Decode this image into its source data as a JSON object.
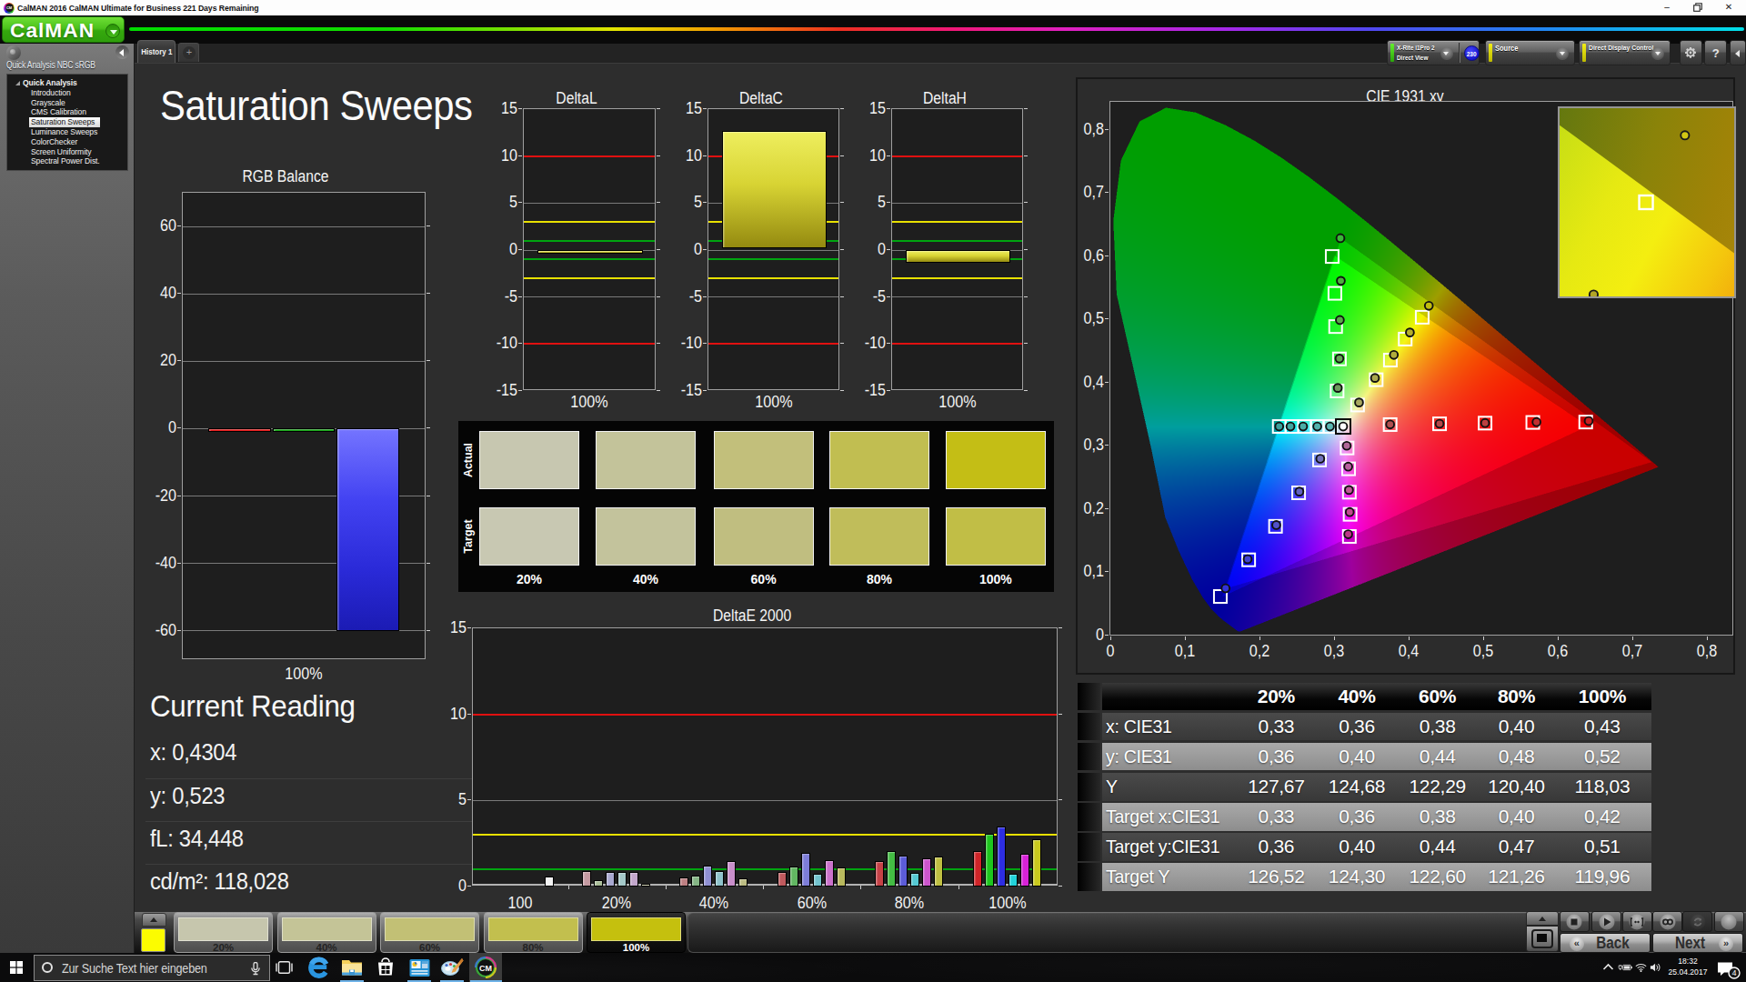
{
  "window": {
    "title": "CalMAN 2016 CalMAN Ultimate for Business 221 Days Remaining",
    "controls": {
      "minimize": "–",
      "restore": "❐",
      "close": "✕"
    }
  },
  "logo": {
    "text": "CalMAN"
  },
  "tabs": {
    "active": "History 1",
    "add": "+"
  },
  "toolbar": {
    "meter": {
      "line1": "X-Rite i1Pro 2",
      "line2": "Direct View",
      "badge": "230"
    },
    "source": {
      "label": "Source"
    },
    "display_control": {
      "label": "Direct Display Control"
    },
    "help": "?"
  },
  "sidebar": {
    "title": "Quick Analysis NBC sRGB",
    "root": "Quick Analysis",
    "items": [
      "Introduction",
      "Grayscale",
      "CMS Calibration",
      "Saturation Sweeps",
      "Luminance Sweeps",
      "ColorChecker",
      "Screen Uniformity",
      "Spectral Power Dist."
    ],
    "selected_index": 3
  },
  "page": {
    "title": "Saturation Sweeps"
  },
  "current_reading": {
    "title": "Current Reading",
    "lines": [
      "x: 0,4304",
      "y: 0,523",
      "fL: 34,448",
      "cd/m²: 118,028"
    ]
  },
  "chart_data": [
    {
      "id": "rgbbalance",
      "type": "bar",
      "title": "RGB Balance",
      "categories": [
        "100%"
      ],
      "ylim": [
        -68.7,
        70
      ],
      "yticks": [
        60,
        40,
        20,
        0,
        -20,
        -40,
        -60
      ],
      "series": [
        {
          "name": "Red",
          "values": [
            -1.0
          ],
          "color": "#e01414"
        },
        {
          "name": "Green",
          "values": [
            -0.9
          ],
          "color": "#12a012"
        },
        {
          "name": "Blue",
          "values": [
            -60.0
          ],
          "color": "blueGradient"
        }
      ],
      "xlabel": "100%"
    },
    {
      "id": "deltaL",
      "type": "bar",
      "title": "DeltaL",
      "categories": [
        "100%"
      ],
      "ylim": [
        -15,
        15
      ],
      "yticks": [
        15,
        10,
        5,
        0,
        -5,
        -10,
        -15
      ],
      "reflines": [
        {
          "v": 10,
          "c": "red"
        },
        {
          "v": -10,
          "c": "red"
        },
        {
          "v": 3,
          "c": "yellow"
        },
        {
          "v": -3,
          "c": "yellow"
        },
        {
          "v": 1,
          "c": "green"
        },
        {
          "v": -1,
          "c": "green"
        }
      ],
      "series": [
        {
          "name": "DeltaL",
          "values": [
            -0.35
          ],
          "color": "yellowGradient"
        }
      ],
      "xlabel": "100%"
    },
    {
      "id": "deltaC",
      "type": "bar",
      "title": "DeltaC",
      "categories": [
        "100%"
      ],
      "ylim": [
        -15,
        15
      ],
      "yticks": [
        15,
        10,
        5,
        0,
        -5,
        -10,
        -15
      ],
      "reflines": [
        {
          "v": 10,
          "c": "red"
        },
        {
          "v": -10,
          "c": "red"
        },
        {
          "v": 3,
          "c": "yellow"
        },
        {
          "v": -3,
          "c": "yellow"
        },
        {
          "v": 1,
          "c": "green"
        },
        {
          "v": -1,
          "c": "green"
        }
      ],
      "series": [
        {
          "name": "DeltaC",
          "values": [
            12.7
          ],
          "color": "yellowGradient",
          "base": 0.2
        }
      ],
      "xlabel": "100%"
    },
    {
      "id": "deltaH",
      "type": "bar",
      "title": "DeltaH",
      "categories": [
        "100%"
      ],
      "ylim": [
        -15,
        15
      ],
      "yticks": [
        15,
        10,
        5,
        0,
        -5,
        -10,
        -15
      ],
      "reflines": [
        {
          "v": 10,
          "c": "red"
        },
        {
          "v": -10,
          "c": "red"
        },
        {
          "v": 3,
          "c": "yellow"
        },
        {
          "v": -3,
          "c": "yellow"
        },
        {
          "v": 1,
          "c": "green"
        },
        {
          "v": -1,
          "c": "green"
        }
      ],
      "series": [
        {
          "name": "DeltaH",
          "values": [
            -1.4
          ],
          "color": "yellowGradient"
        }
      ],
      "xlabel": "100%"
    },
    {
      "id": "deltaE",
      "type": "bar",
      "title": "DeltaE 2000",
      "categories": [
        "100",
        "20%",
        "40%",
        "60%",
        "80%",
        "100%"
      ],
      "ylim": [
        0,
        15
      ],
      "yticks": [
        15,
        10,
        5,
        0
      ],
      "reflines": [
        {
          "v": 10,
          "c": "red"
        },
        {
          "v": 3,
          "c": "yellow"
        },
        {
          "v": 1,
          "c": "green"
        }
      ],
      "groups": [
        {
          "label": "100",
          "bars": [
            {
              "v": 0.56,
              "color": "#f2f2f2",
              "slot": 5
            }
          ]
        },
        {
          "label": "20%",
          "bars": [
            {
              "v": 0.89,
              "color": "#c59aa1"
            },
            {
              "v": 0.38,
              "color": "#a9bd97"
            },
            {
              "v": 0.86,
              "color": "#a9a9d0"
            },
            {
              "v": 0.84,
              "color": "#a4c8c8"
            },
            {
              "v": 0.86,
              "color": "#c3a7cb"
            },
            {
              "v": 0.18,
              "color": "#c9c9a1"
            }
          ]
        },
        {
          "label": "40%",
          "bars": [
            {
              "v": 0.55,
              "color": "#bd7f82"
            },
            {
              "v": 0.65,
              "color": "#85b585"
            },
            {
              "v": 1.22,
              "color": "#9090d2"
            },
            {
              "v": 0.88,
              "color": "#8fc3cb"
            },
            {
              "v": 1.5,
              "color": "#c98fcb"
            },
            {
              "v": 0.45,
              "color": "#bcbc83"
            }
          ]
        },
        {
          "label": "60%",
          "bars": [
            {
              "v": 0.82,
              "color": "#c05a5e"
            },
            {
              "v": 1.18,
              "color": "#62b762"
            },
            {
              "v": 1.95,
              "color": "#7d7dd8"
            },
            {
              "v": 0.72,
              "color": "#72c3cd"
            },
            {
              "v": 1.55,
              "color": "#cb72cb"
            },
            {
              "v": 1.1,
              "color": "#b9b95e"
            }
          ]
        },
        {
          "label": "80%",
          "bars": [
            {
              "v": 1.5,
              "color": "#c64247"
            },
            {
              "v": 2.05,
              "color": "#44bc44"
            },
            {
              "v": 1.82,
              "color": "#5c5cd8"
            },
            {
              "v": 0.78,
              "color": "#55c8d2"
            },
            {
              "v": 1.62,
              "color": "#cc55cc"
            },
            {
              "v": 1.72,
              "color": "#bfbf42"
            }
          ]
        },
        {
          "label": "100%",
          "bars": [
            {
              "v": 2.05,
              "color": "#d02428"
            },
            {
              "v": 3.05,
              "color": "#1ec51e"
            },
            {
              "v": 3.5,
              "color": "#2d2de2"
            },
            {
              "v": 0.72,
              "color": "#22d2da"
            },
            {
              "v": 1.9,
              "color": "#d822d8"
            },
            {
              "v": 2.75,
              "color": "#c9c91e"
            }
          ]
        }
      ]
    },
    {
      "id": "cie",
      "type": "scatter",
      "title": "CIE 1931 xy",
      "xlim": [
        0,
        0.836
      ],
      "ylim": [
        0,
        0.845
      ],
      "xticks": [
        "0",
        "0,1",
        "0,2",
        "0,3",
        "0,4",
        "0,5",
        "0,6",
        "0,7",
        "0,8"
      ],
      "yticks": [
        "0",
        "0,1",
        "0,2",
        "0,3",
        "0,4",
        "0,5",
        "0,6",
        "0,7",
        "0,8"
      ],
      "white_point": {
        "x": 0.3127,
        "y": 0.329
      },
      "srgb_triangle": [
        [
          0.64,
          0.33
        ],
        [
          0.3,
          0.6
        ],
        [
          0.15,
          0.06
        ]
      ],
      "native_triangle": [
        [
          0.7255,
          0.273
        ],
        [
          0.309,
          0.627
        ],
        [
          0.155,
          0.073
        ]
      ],
      "targets": {
        "red": [
          [
            0.3757,
            0.332
          ],
          [
            0.442,
            0.3332
          ],
          [
            0.503,
            0.3343
          ],
          [
            0.567,
            0.3354
          ],
          [
            0.638,
            0.336
          ]
        ],
        "green": [
          [
            0.3046,
            0.3852
          ],
          [
            0.3077,
            0.4359
          ],
          [
            0.3026,
            0.4871
          ],
          [
            0.3016,
            0.5397
          ],
          [
            0.298,
            0.598
          ]
        ],
        "blue": [
          [
            0.281,
            0.276
          ],
          [
            0.253,
            0.224
          ],
          [
            0.222,
            0.171
          ],
          [
            0.186,
            0.118
          ],
          [
            0.148,
            0.06
          ]
        ],
        "cyan": [
          [
            0.295,
            0.329
          ],
          [
            0.278,
            0.329
          ],
          [
            0.261,
            0.329
          ],
          [
            0.244,
            0.329
          ],
          [
            0.227,
            0.329
          ]
        ],
        "magenta": [
          [
            0.318,
            0.295
          ],
          [
            0.32,
            0.262
          ],
          [
            0.321,
            0.225
          ],
          [
            0.322,
            0.19
          ],
          [
            0.321,
            0.155
          ]
        ],
        "yellow": [
          [
            0.332,
            0.363
          ],
          [
            0.357,
            0.403
          ],
          [
            0.376,
            0.434
          ],
          [
            0.3959,
            0.4673
          ],
          [
            0.4187,
            0.5019
          ]
        ]
      },
      "measured": {
        "red": {
          "pts": [
            [
              0.3757,
              0.3322
            ],
            [
              0.442,
              0.3334
            ],
            [
              0.503,
              0.3345
            ],
            [
              0.572,
              0.336
            ],
            [
              0.642,
              0.3377
            ]
          ],
          "fills": [
            "#b05050",
            "#b34848",
            "#bc4040",
            "#c23030",
            "#cc2020"
          ]
        },
        "green": {
          "pts": [
            [
              0.3055,
              0.39
            ],
            [
              0.3077,
              0.4365
            ],
            [
              0.3083,
              0.4975
            ],
            [
              0.3096,
              0.5595
            ],
            [
              0.309,
              0.627
            ]
          ],
          "fills": [
            "#6f9c5e",
            "#64a354",
            "#58aa49",
            "#4cb03e",
            "#3ab838"
          ]
        },
        "blue": {
          "pts": [
            [
              0.282,
              0.278
            ],
            [
              0.254,
              0.226
            ],
            [
              0.223,
              0.173
            ],
            [
              0.1846,
              0.119
            ],
            [
              0.155,
              0.0729
            ]
          ],
          "fills": [
            "#7272ba",
            "#6262c2",
            "#5252ca",
            "#4242d2",
            "#3232da"
          ]
        },
        "cyan": {
          "pts": [
            [
              0.227,
              0.329
            ],
            [
              0.242,
              0.329
            ],
            [
              0.259,
              0.329
            ],
            [
              0.278,
              0.329
            ],
            [
              0.295,
              0.329
            ]
          ],
          "fills": [
            "#3a9f9a",
            "#42a5a0",
            "#4aaca6",
            "#52b2ac",
            "#5ab8b2"
          ]
        },
        "magenta": {
          "pts": [
            [
              0.3175,
              0.2985
            ],
            [
              0.3195,
              0.2655
            ],
            [
              0.3205,
              0.2285
            ],
            [
              0.3215,
              0.1935
            ],
            [
              0.3195,
              0.1585
            ]
          ],
          "fills": [
            "#b06898",
            "#b860a0",
            "#c05898",
            "#c24890",
            "#bc3888"
          ]
        },
        "yellow": {
          "pts": [
            [
              0.334,
              0.367
            ],
            [
              0.3554,
              0.4058
            ],
            [
              0.3807,
              0.4423
            ],
            [
              0.4022,
              0.4778
            ],
            [
              0.4276,
              0.52
            ]
          ],
          "fills": [
            "#a8a860",
            "#aaa84e",
            "#b0ac3c",
            "#b4ae2c",
            "#c0bc10"
          ]
        }
      },
      "inset": {
        "square": {
          "xp": 49.5,
          "yp": 50
        },
        "circles": [
          {
            "xp": 71.8,
            "yp": 14.4,
            "fill": "#d2c614"
          },
          {
            "xp": 19.5,
            "yp": 99,
            "fill": "#b2a626"
          }
        ]
      }
    },
    {
      "id": "sweep_table",
      "type": "table",
      "columns": [
        "",
        "20%",
        "40%",
        "60%",
        "80%",
        "100%"
      ],
      "rows": [
        {
          "label": "x: CIE31",
          "values": [
            "0,33",
            "0,36",
            "0,38",
            "0,40",
            "0,43"
          ],
          "shade": "dark"
        },
        {
          "label": "y: CIE31",
          "values": [
            "0,36",
            "0,40",
            "0,44",
            "0,48",
            "0,52"
          ],
          "shade": "light"
        },
        {
          "label": "Y",
          "values": [
            "127,67",
            "124,68",
            "122,29",
            "120,40",
            "118,03"
          ],
          "shade": "dark"
        },
        {
          "label": "Target x:CIE31",
          "values": [
            "0,33",
            "0,36",
            "0,38",
            "0,40",
            "0,42"
          ],
          "shade": "light"
        },
        {
          "label": "Target y:CIE31",
          "values": [
            "0,36",
            "0,40",
            "0,44",
            "0,47",
            "0,51"
          ],
          "shade": "dark"
        },
        {
          "label": "Target Y",
          "values": [
            "126,52",
            "124,30",
            "122,60",
            "121,26",
            "119,96"
          ],
          "shade": "light"
        }
      ]
    }
  ],
  "swatches": {
    "row_labels": [
      "Actual",
      "Target"
    ],
    "col_labels": [
      "20%",
      "40%",
      "60%",
      "80%",
      "100%"
    ],
    "actual": [
      "#c7c7b0",
      "#c3c39a",
      "#c2bf7b",
      "#c1be51",
      "#c4be15"
    ],
    "target": [
      "#c8c8b2",
      "#c3c39c",
      "#c0be80",
      "#c0bd5a",
      "#c1be46"
    ]
  },
  "bottom_bar": {
    "patches": [
      {
        "label": "20%",
        "color": "#c6c6ad",
        "active": false
      },
      {
        "label": "40%",
        "color": "#c4c497",
        "active": false
      },
      {
        "label": "60%",
        "color": "#c2c075",
        "active": false
      },
      {
        "label": "80%",
        "color": "#c2bf4e",
        "active": false
      },
      {
        "label": "100%",
        "color": "#c5c00e",
        "active": true
      }
    ],
    "preview_color": "#fcfc00",
    "back_label": "Back",
    "next_label": "Next"
  },
  "taskbar": {
    "search_placeholder": "Zur Suche Text hier eingeben",
    "time": "18:32",
    "date": "25.04.2017",
    "notification_count": "4"
  }
}
